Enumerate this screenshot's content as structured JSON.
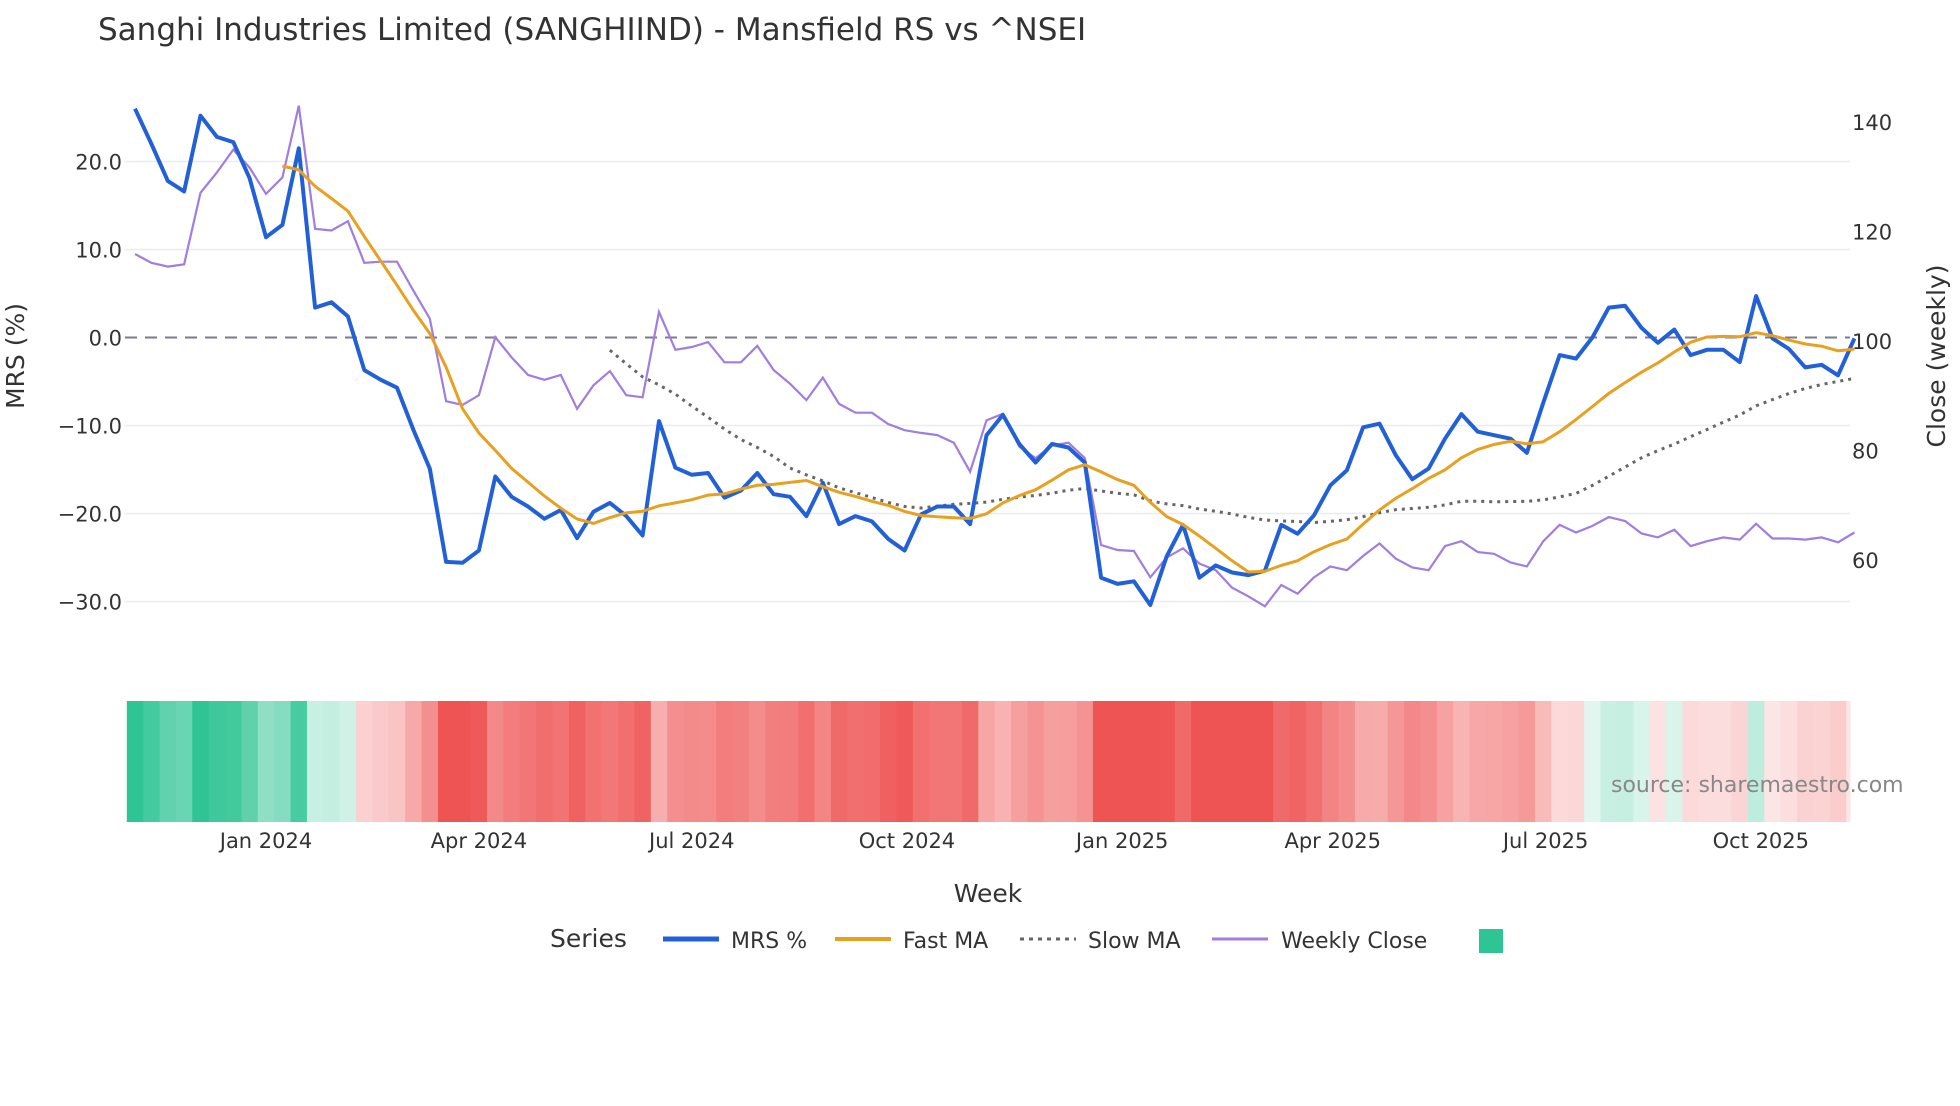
{
  "chart_data": {
    "type": "line",
    "title": "Sanghi Industries Limited (SANGHIIND) - Mansfield RS vs ^NSEI",
    "xlabel": "Week",
    "ylabel_left": "MRS (%)",
    "ylabel_right": "Close (weekly)",
    "start_week": "2023-11-06",
    "y_left_ticks": [
      20,
      10,
      0,
      -10,
      -20,
      -30
    ],
    "y_left_tick_labels": [
      "20.0",
      "10.0",
      "0.0",
      "−10.0",
      "−20.0",
      "−30.0"
    ],
    "y_right_ticks": [
      140,
      120,
      100,
      80,
      60
    ],
    "y_right_tick_labels": [
      "140",
      "120",
      "100",
      "80",
      "60"
    ],
    "x_ticks": [
      {
        "date": "2024-01-01",
        "label": "Jan 2024"
      },
      {
        "date": "2024-04-01",
        "label": "Apr 2024"
      },
      {
        "date": "2024-07-01",
        "label": "Jul 2024"
      },
      {
        "date": "2024-10-01",
        "label": "Oct 2024"
      },
      {
        "date": "2025-01-01",
        "label": "Jan 2025"
      },
      {
        "date": "2025-04-01",
        "label": "Apr 2025"
      },
      {
        "date": "2025-07-01",
        "label": "Jul 2025"
      },
      {
        "date": "2025-10-01",
        "label": "Oct 2025"
      }
    ],
    "zero_line": 0,
    "fast_ma_window": 10,
    "slow_ma_window": 30,
    "series": [
      {
        "name": "MRS %",
        "color": "#2260d8",
        "axis": "left",
        "values": [
          26.0,
          22.0,
          17.8,
          16.6,
          25.2,
          22.8,
          22.2,
          18.1,
          11.4,
          12.8,
          21.5,
          3.4,
          4.0,
          2.4,
          -3.7,
          -4.8,
          -5.7,
          -10.5,
          -14.9,
          -25.5,
          -25.6,
          -24.2,
          -15.8,
          -18.1,
          -19.2,
          -20.6,
          -19.6,
          -22.8,
          -19.8,
          -18.8,
          -20.3,
          -22.5,
          -9.5,
          -14.8,
          -15.6,
          -15.4,
          -18.2,
          -17.4,
          -15.4,
          -17.8,
          -18.1,
          -20.3,
          -16.5,
          -21.2,
          -20.3,
          -20.9,
          -22.9,
          -24.2,
          -20.1,
          -19.2,
          -19.2,
          -21.2,
          -11.1,
          -8.8,
          -12.1,
          -14.2,
          -12.1,
          -12.5,
          -14.2,
          -27.3,
          -28.0,
          -27.7,
          -30.4,
          -24.9,
          -21.3,
          -27.3,
          -25.9,
          -26.7,
          -27.0,
          -26.5,
          -21.3,
          -22.3,
          -20.2,
          -16.8,
          -15.1,
          -10.2,
          -9.8,
          -13.4,
          -16.1,
          -14.9,
          -11.5,
          -8.7,
          -10.7,
          -11.1,
          -11.5,
          -13.1,
          -7.4,
          -2.0,
          -2.4,
          0.0,
          3.4,
          3.6,
          1.1,
          -0.6,
          0.9,
          -2.0,
          -1.4,
          -1.4,
          -2.8,
          4.7,
          -0.1,
          -1.3,
          -3.4,
          -3.1,
          -4.3,
          -0.1
        ]
      },
      {
        "name": "Fast MA",
        "color": "#e8a020",
        "axis": "left",
        "derived": "SMA of MRS %"
      },
      {
        "name": "Slow MA",
        "color": "#666666",
        "axis": "left",
        "derived": "SMA of MRS %"
      },
      {
        "name": "Weekly Close",
        "color": "#a07de0",
        "axis": "right",
        "values": [
          115.9,
          114.3,
          113.6,
          114.0,
          127.1,
          130.8,
          135.0,
          131.7,
          126.9,
          129.9,
          143.0,
          120.5,
          120.2,
          121.9,
          114.3,
          114.5,
          114.5,
          109.2,
          104.1,
          89.0,
          88.3,
          90.1,
          100.7,
          97.0,
          93.8,
          92.9,
          93.8,
          87.6,
          91.9,
          94.5,
          90.1,
          89.7,
          105.3,
          98.4,
          98.9,
          99.8,
          96.1,
          96.1,
          99.1,
          94.7,
          92.2,
          89.2,
          93.3,
          88.5,
          86.9,
          86.9,
          84.8,
          83.7,
          83.2,
          82.8,
          81.4,
          76.1,
          85.5,
          86.7,
          80.7,
          78.6,
          80.9,
          81.4,
          78.6,
          62.7,
          61.8,
          61.6,
          56.8,
          60.4,
          62.1,
          59.3,
          58.1,
          54.9,
          53.3,
          51.5,
          55.4,
          53.8,
          56.8,
          58.8,
          58.1,
          60.7,
          63.0,
          60.2,
          58.6,
          58.1,
          62.5,
          63.4,
          61.4,
          61.1,
          59.5,
          58.8,
          63.4,
          66.4,
          65.0,
          66.2,
          67.8,
          67.1,
          64.8,
          64.1,
          65.5,
          62.5,
          63.4,
          64.1,
          63.7,
          66.6,
          63.9,
          63.9,
          63.7,
          64.1,
          63.2,
          65.0
        ]
      }
    ],
    "heatmap": {
      "based_on": "MRS %",
      "positive_color": "#2ec493",
      "negative_color": "#ef5454"
    },
    "legend": {
      "title": "Series",
      "placement": "bottom",
      "items": [
        "MRS %",
        "Fast MA",
        "Slow MA",
        "Weekly Close"
      ]
    },
    "annotation": "source: sharemaestro.com"
  }
}
